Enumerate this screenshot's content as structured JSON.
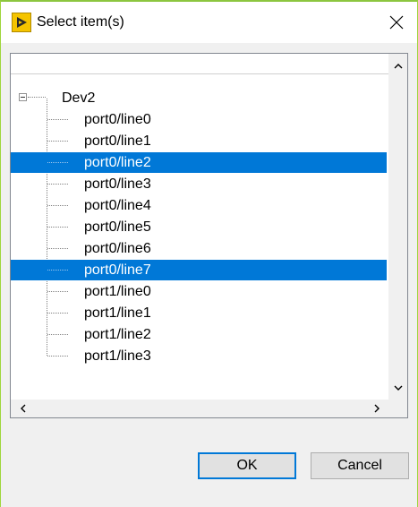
{
  "window": {
    "title": "Select item(s)"
  },
  "tree": {
    "root": {
      "label": "Dev2",
      "expanded": true
    },
    "items": [
      {
        "label": "port0/line0",
        "selected": false
      },
      {
        "label": "port0/line1",
        "selected": false
      },
      {
        "label": "port0/line2",
        "selected": true
      },
      {
        "label": "port0/line3",
        "selected": false
      },
      {
        "label": "port0/line4",
        "selected": false
      },
      {
        "label": "port0/line5",
        "selected": false
      },
      {
        "label": "port0/line6",
        "selected": false
      },
      {
        "label": "port0/line7",
        "selected": true
      },
      {
        "label": "port1/line0",
        "selected": false
      },
      {
        "label": "port1/line1",
        "selected": false
      },
      {
        "label": "port1/line2",
        "selected": false
      },
      {
        "label": "port1/line3",
        "selected": false
      }
    ]
  },
  "buttons": {
    "ok_label": "OK",
    "cancel_label": "Cancel"
  },
  "colors": {
    "selection": "#0078d7",
    "window_border": "#8cc63f",
    "app_icon": "#f5c400"
  },
  "icons": {
    "app": "labview-app-icon",
    "close": "close-icon",
    "scroll_up": "chevron-up-icon",
    "scroll_down": "chevron-down-icon",
    "scroll_left": "chevron-left-icon",
    "scroll_right": "chevron-right-icon",
    "expander": "collapse-minus-icon"
  }
}
